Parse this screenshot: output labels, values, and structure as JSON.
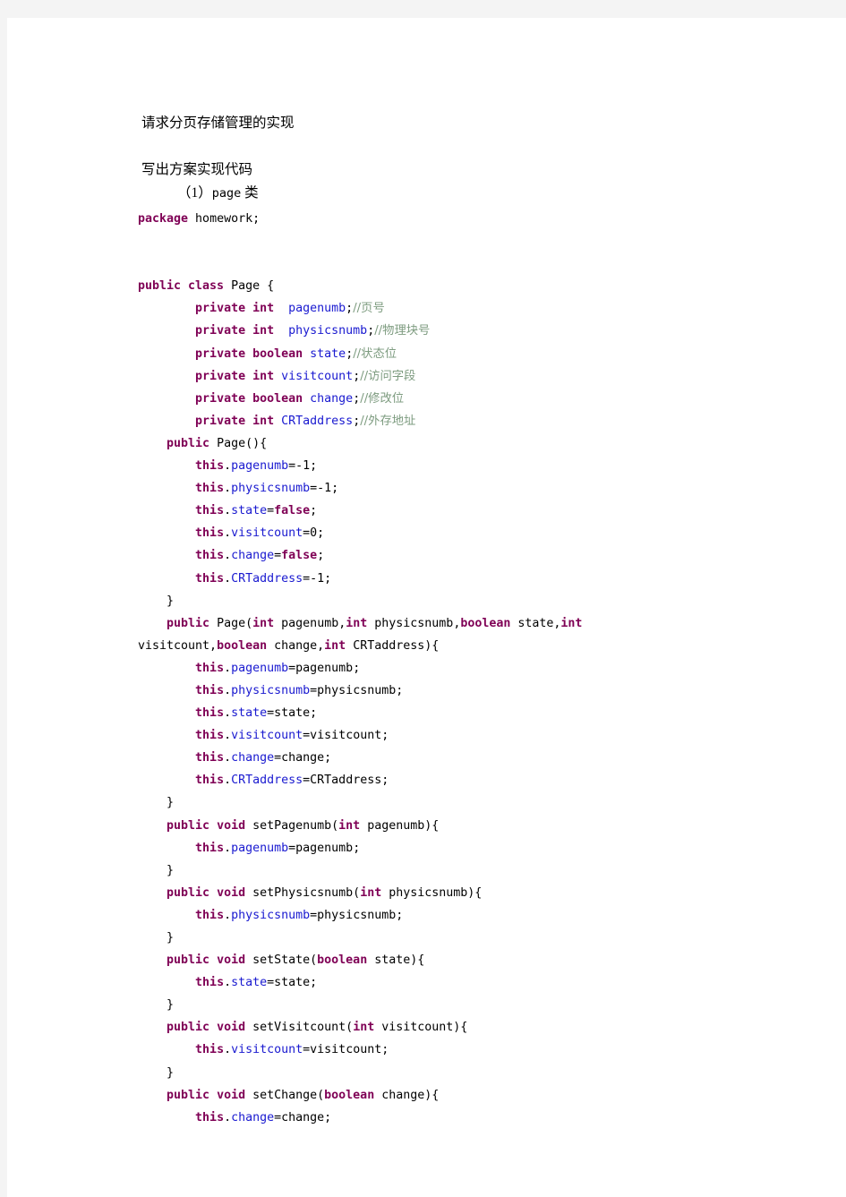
{
  "document": {
    "heading": "请求分页存储管理的实现",
    "subheading": "写出方案实现代码",
    "section_label_prefix": "（1）",
    "section_label_code": "page",
    "section_label_suffix": " 类"
  },
  "colors": {
    "page_background": "#ffffff",
    "canvas_background": "#f4f4f4",
    "keyword": "#7f0055",
    "field": "#1a1ad0",
    "comment": "#7e9c80",
    "plain": "#000000"
  },
  "code": {
    "language": "java",
    "lines": [
      [
        {
          "t": "package",
          "c": "kw"
        },
        {
          "t": " homework;",
          "c": "pl"
        }
      ],
      [],
      [],
      [
        {
          "t": "public class",
          "c": "kw"
        },
        {
          "t": " Page {",
          "c": "pl"
        }
      ],
      [
        {
          "t": "        ",
          "c": "pl"
        },
        {
          "t": "private int",
          "c": "kw"
        },
        {
          "t": "  ",
          "c": "pl"
        },
        {
          "t": "pagenumb",
          "c": "fld"
        },
        {
          "t": ";",
          "c": "pl"
        },
        {
          "t": "//页号",
          "c": "cmt"
        }
      ],
      [
        {
          "t": "        ",
          "c": "pl"
        },
        {
          "t": "private int",
          "c": "kw"
        },
        {
          "t": "  ",
          "c": "pl"
        },
        {
          "t": "physicsnumb",
          "c": "fld"
        },
        {
          "t": ";",
          "c": "pl"
        },
        {
          "t": "//物理块号",
          "c": "cmt"
        }
      ],
      [
        {
          "t": "        ",
          "c": "pl"
        },
        {
          "t": "private boolean",
          "c": "kw"
        },
        {
          "t": " ",
          "c": "pl"
        },
        {
          "t": "state",
          "c": "fld"
        },
        {
          "t": ";",
          "c": "pl"
        },
        {
          "t": "//状态位",
          "c": "cmt"
        }
      ],
      [
        {
          "t": "        ",
          "c": "pl"
        },
        {
          "t": "private int",
          "c": "kw"
        },
        {
          "t": " ",
          "c": "pl"
        },
        {
          "t": "visitcount",
          "c": "fld"
        },
        {
          "t": ";",
          "c": "pl"
        },
        {
          "t": "//访问字段",
          "c": "cmt"
        }
      ],
      [
        {
          "t": "        ",
          "c": "pl"
        },
        {
          "t": "private boolean",
          "c": "kw"
        },
        {
          "t": " ",
          "c": "pl"
        },
        {
          "t": "change",
          "c": "fld"
        },
        {
          "t": ";",
          "c": "pl"
        },
        {
          "t": "//修改位",
          "c": "cmt"
        }
      ],
      [
        {
          "t": "        ",
          "c": "pl"
        },
        {
          "t": "private int",
          "c": "kw"
        },
        {
          "t": " ",
          "c": "pl"
        },
        {
          "t": "CRTaddress",
          "c": "fld"
        },
        {
          "t": ";",
          "c": "pl"
        },
        {
          "t": "//外存地址",
          "c": "cmt"
        }
      ],
      [
        {
          "t": "    ",
          "c": "pl"
        },
        {
          "t": "public",
          "c": "kw"
        },
        {
          "t": " Page(){",
          "c": "pl"
        }
      ],
      [
        {
          "t": "        ",
          "c": "pl"
        },
        {
          "t": "this",
          "c": "kw"
        },
        {
          "t": ".",
          "c": "pl"
        },
        {
          "t": "pagenumb",
          "c": "fld"
        },
        {
          "t": "=-1;",
          "c": "pl"
        }
      ],
      [
        {
          "t": "        ",
          "c": "pl"
        },
        {
          "t": "this",
          "c": "kw"
        },
        {
          "t": ".",
          "c": "pl"
        },
        {
          "t": "physicsnumb",
          "c": "fld"
        },
        {
          "t": "=-1;",
          "c": "pl"
        }
      ],
      [
        {
          "t": "        ",
          "c": "pl"
        },
        {
          "t": "this",
          "c": "kw"
        },
        {
          "t": ".",
          "c": "pl"
        },
        {
          "t": "state",
          "c": "fld"
        },
        {
          "t": "=",
          "c": "pl"
        },
        {
          "t": "false",
          "c": "kw"
        },
        {
          "t": ";",
          "c": "pl"
        }
      ],
      [
        {
          "t": "        ",
          "c": "pl"
        },
        {
          "t": "this",
          "c": "kw"
        },
        {
          "t": ".",
          "c": "pl"
        },
        {
          "t": "visitcount",
          "c": "fld"
        },
        {
          "t": "=0;",
          "c": "pl"
        }
      ],
      [
        {
          "t": "        ",
          "c": "pl"
        },
        {
          "t": "this",
          "c": "kw"
        },
        {
          "t": ".",
          "c": "pl"
        },
        {
          "t": "change",
          "c": "fld"
        },
        {
          "t": "=",
          "c": "pl"
        },
        {
          "t": "false",
          "c": "kw"
        },
        {
          "t": ";",
          "c": "pl"
        }
      ],
      [
        {
          "t": "        ",
          "c": "pl"
        },
        {
          "t": "this",
          "c": "kw"
        },
        {
          "t": ".",
          "c": "pl"
        },
        {
          "t": "CRTaddress",
          "c": "fld"
        },
        {
          "t": "=-1;",
          "c": "pl"
        }
      ],
      [
        {
          "t": "    }",
          "c": "pl"
        }
      ],
      [
        {
          "t": "    ",
          "c": "pl"
        },
        {
          "t": "public",
          "c": "kw"
        },
        {
          "t": " Page(",
          "c": "pl"
        },
        {
          "t": "int",
          "c": "kw"
        },
        {
          "t": " pagenumb,",
          "c": "pl"
        },
        {
          "t": "int",
          "c": "kw"
        },
        {
          "t": " physicsnumb,",
          "c": "pl"
        },
        {
          "t": "boolean",
          "c": "kw"
        },
        {
          "t": " state,",
          "c": "pl"
        },
        {
          "t": "int",
          "c": "kw"
        }
      ],
      [
        {
          "t": "visitcount,",
          "c": "pl"
        },
        {
          "t": "boolean",
          "c": "kw"
        },
        {
          "t": " change,",
          "c": "pl"
        },
        {
          "t": "int",
          "c": "kw"
        },
        {
          "t": " CRTaddress){",
          "c": "pl"
        }
      ],
      [
        {
          "t": "        ",
          "c": "pl"
        },
        {
          "t": "this",
          "c": "kw"
        },
        {
          "t": ".",
          "c": "pl"
        },
        {
          "t": "pagenumb",
          "c": "fld"
        },
        {
          "t": "=pagenumb;",
          "c": "pl"
        }
      ],
      [
        {
          "t": "        ",
          "c": "pl"
        },
        {
          "t": "this",
          "c": "kw"
        },
        {
          "t": ".",
          "c": "pl"
        },
        {
          "t": "physicsnumb",
          "c": "fld"
        },
        {
          "t": "=physicsnumb;",
          "c": "pl"
        }
      ],
      [
        {
          "t": "        ",
          "c": "pl"
        },
        {
          "t": "this",
          "c": "kw"
        },
        {
          "t": ".",
          "c": "pl"
        },
        {
          "t": "state",
          "c": "fld"
        },
        {
          "t": "=state;",
          "c": "pl"
        }
      ],
      [
        {
          "t": "        ",
          "c": "pl"
        },
        {
          "t": "this",
          "c": "kw"
        },
        {
          "t": ".",
          "c": "pl"
        },
        {
          "t": "visitcount",
          "c": "fld"
        },
        {
          "t": "=visitcount;",
          "c": "pl"
        }
      ],
      [
        {
          "t": "        ",
          "c": "pl"
        },
        {
          "t": "this",
          "c": "kw"
        },
        {
          "t": ".",
          "c": "pl"
        },
        {
          "t": "change",
          "c": "fld"
        },
        {
          "t": "=change;",
          "c": "pl"
        }
      ],
      [
        {
          "t": "        ",
          "c": "pl"
        },
        {
          "t": "this",
          "c": "kw"
        },
        {
          "t": ".",
          "c": "pl"
        },
        {
          "t": "CRTaddress",
          "c": "fld"
        },
        {
          "t": "=CRTaddress;",
          "c": "pl"
        }
      ],
      [
        {
          "t": "    }",
          "c": "pl"
        }
      ],
      [
        {
          "t": "    ",
          "c": "pl"
        },
        {
          "t": "public void",
          "c": "kw"
        },
        {
          "t": " setPagenumb(",
          "c": "pl"
        },
        {
          "t": "int",
          "c": "kw"
        },
        {
          "t": " pagenumb){",
          "c": "pl"
        }
      ],
      [
        {
          "t": "        ",
          "c": "pl"
        },
        {
          "t": "this",
          "c": "kw"
        },
        {
          "t": ".",
          "c": "pl"
        },
        {
          "t": "pagenumb",
          "c": "fld"
        },
        {
          "t": "=pagenumb;",
          "c": "pl"
        }
      ],
      [
        {
          "t": "    }",
          "c": "pl"
        }
      ],
      [
        {
          "t": "    ",
          "c": "pl"
        },
        {
          "t": "public void",
          "c": "kw"
        },
        {
          "t": " setPhysicsnumb(",
          "c": "pl"
        },
        {
          "t": "int",
          "c": "kw"
        },
        {
          "t": " physicsnumb){",
          "c": "pl"
        }
      ],
      [
        {
          "t": "        ",
          "c": "pl"
        },
        {
          "t": "this",
          "c": "kw"
        },
        {
          "t": ".",
          "c": "pl"
        },
        {
          "t": "physicsnumb",
          "c": "fld"
        },
        {
          "t": "=physicsnumb;",
          "c": "pl"
        }
      ],
      [
        {
          "t": "    }",
          "c": "pl"
        }
      ],
      [
        {
          "t": "    ",
          "c": "pl"
        },
        {
          "t": "public void",
          "c": "kw"
        },
        {
          "t": " setState(",
          "c": "pl"
        },
        {
          "t": "boolean",
          "c": "kw"
        },
        {
          "t": " state){",
          "c": "pl"
        }
      ],
      [
        {
          "t": "        ",
          "c": "pl"
        },
        {
          "t": "this",
          "c": "kw"
        },
        {
          "t": ".",
          "c": "pl"
        },
        {
          "t": "state",
          "c": "fld"
        },
        {
          "t": "=state;",
          "c": "pl"
        }
      ],
      [
        {
          "t": "    }",
          "c": "pl"
        }
      ],
      [
        {
          "t": "    ",
          "c": "pl"
        },
        {
          "t": "public void",
          "c": "kw"
        },
        {
          "t": " setVisitcount(",
          "c": "pl"
        },
        {
          "t": "int",
          "c": "kw"
        },
        {
          "t": " visitcount){",
          "c": "pl"
        }
      ],
      [
        {
          "t": "        ",
          "c": "pl"
        },
        {
          "t": "this",
          "c": "kw"
        },
        {
          "t": ".",
          "c": "pl"
        },
        {
          "t": "visitcount",
          "c": "fld"
        },
        {
          "t": "=visitcount;",
          "c": "pl"
        }
      ],
      [
        {
          "t": "    }",
          "c": "pl"
        }
      ],
      [
        {
          "t": "    ",
          "c": "pl"
        },
        {
          "t": "public void",
          "c": "kw"
        },
        {
          "t": " setChange(",
          "c": "pl"
        },
        {
          "t": "boolean",
          "c": "kw"
        },
        {
          "t": " change){",
          "c": "pl"
        }
      ],
      [
        {
          "t": "        ",
          "c": "pl"
        },
        {
          "t": "this",
          "c": "kw"
        },
        {
          "t": ".",
          "c": "pl"
        },
        {
          "t": "change",
          "c": "fld"
        },
        {
          "t": "=change;",
          "c": "pl"
        }
      ]
    ]
  }
}
